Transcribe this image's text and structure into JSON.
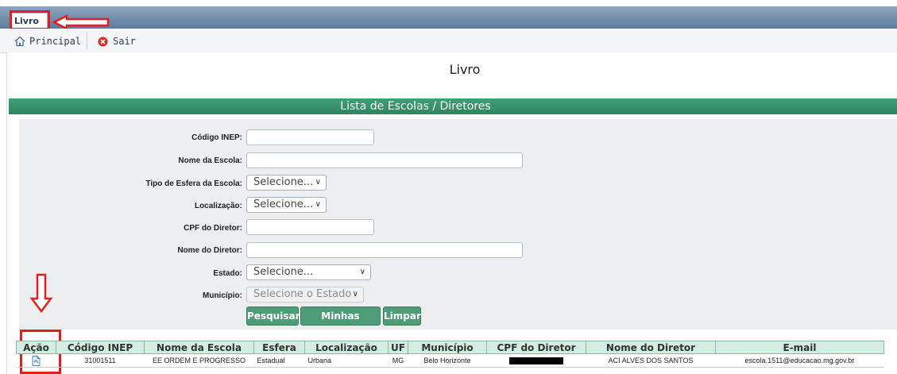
{
  "window": {
    "tab_label": "Livro"
  },
  "toolbar": {
    "home_label": "Principal",
    "exit_label": "Sair"
  },
  "page": {
    "title": "Livro",
    "section_title": "Lista de Escolas / Diretores"
  },
  "form": {
    "codigo_inep_label": "Código INEP:",
    "nome_escola_label": "Nome da Escola:",
    "tipo_esfera_label": "Tipo de Esfera da Escola:",
    "tipo_esfera_value": "Selecione...",
    "localizacao_label": "Localização:",
    "localizacao_value": "Selecione...",
    "cpf_diretor_label": "CPF do Diretor:",
    "nome_diretor_label": "Nome do Diretor:",
    "estado_label": "Estado:",
    "estado_value": "Selecione...",
    "municipio_label": "Município:",
    "municipio_value": "Selecione o Estado",
    "pesquisar_label": "Pesquisar",
    "minhas_escolas_label": "Minhas escolas",
    "limpar_label": "Limpar"
  },
  "table": {
    "columns": [
      "Ação",
      "Código INEP",
      "Nome da Escola",
      "Esfera",
      "Localização",
      "UF",
      "Município",
      "CPF do Diretor",
      "Nome do Diretor",
      "E-mail"
    ],
    "rows": [
      {
        "codigo": "31001511",
        "nome": "EE ORDEM E PROGRESSO",
        "esfera": "Estadual",
        "localizacao": "Urbana",
        "uf": "MG",
        "municipio": "Belo Horizonte",
        "cpf": "",
        "diretor": "ACI ALVES DOS SANTOS",
        "email": "escola.1511@educacao.mg.gov.br"
      }
    ]
  },
  "icons": {
    "home": "home-icon",
    "exit": "close-circle-icon",
    "action": "document-icon",
    "select": "chevron-down-icon"
  },
  "colors": {
    "header_band": "#5c7c9f",
    "section_bar": "#2f8660",
    "button": "#4f9c79",
    "highlight": "#e02020"
  }
}
